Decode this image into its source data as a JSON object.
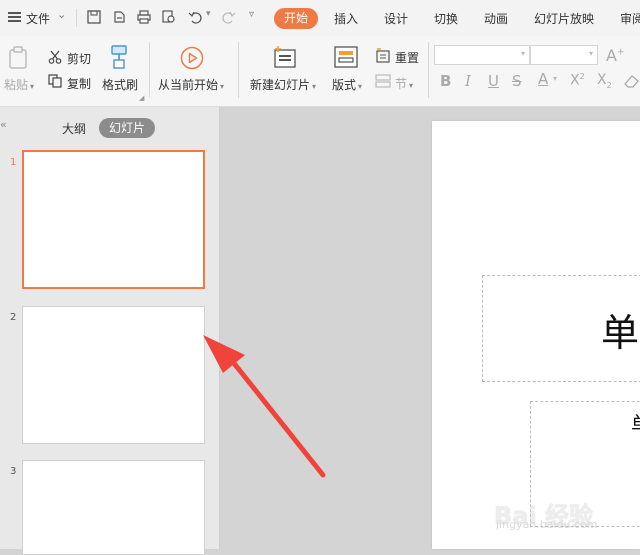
{
  "menu": {
    "file_label": "文件",
    "tabs": [
      "开始",
      "插入",
      "设计",
      "切换",
      "动画",
      "幻灯片放映",
      "审阅"
    ]
  },
  "ribbon": {
    "paste_label": "粘贴",
    "cut_label": "剪切",
    "copy_label": "复制",
    "format_painter_label": "格式刷",
    "play_from_current_label": "从当前开始",
    "new_slide_label": "新建幻灯片",
    "layout_label": "版式",
    "reset_label": "重置",
    "section_label": "节"
  },
  "panel": {
    "outline_tab": "大纲",
    "slides_tab": "幻灯片",
    "slide_numbers": [
      "1",
      "2",
      "3"
    ]
  },
  "slide": {
    "title_text": "单",
    "subtitle_text": "单"
  },
  "colors": {
    "accent": "#f07a45",
    "arrow": "#f0443a"
  },
  "watermark": {
    "text": "Bai 经验",
    "url": "jingyan.baidu.com"
  }
}
